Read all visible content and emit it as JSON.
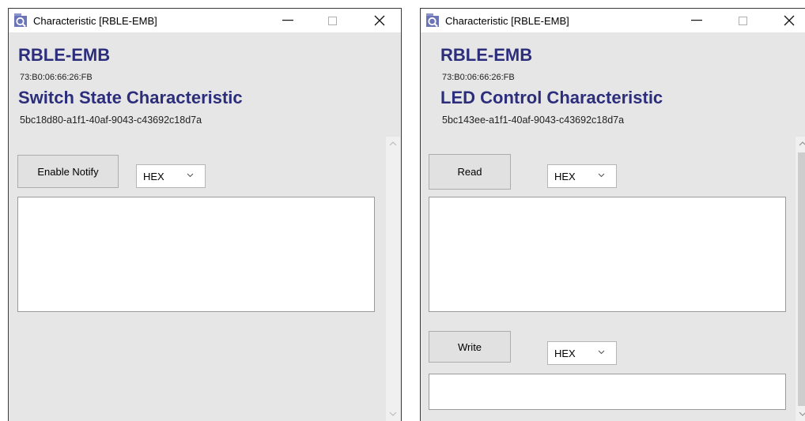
{
  "left_window": {
    "title": "Characteristic [RBLE-EMB]",
    "device_name": "RBLE-EMB",
    "device_address": "73:B0:06:66:26:FB",
    "characteristic_name": "Switch State Characteristic",
    "characteristic_uuid": "5bc18d80-a1f1-40af-9043-c43692c18d7a",
    "notify_button": "Enable Notify",
    "format_select": "HEX",
    "value_text": ""
  },
  "right_window": {
    "title": "Characteristic [RBLE-EMB]",
    "device_name": "RBLE-EMB",
    "device_address": "73:B0:06:66:26:FB",
    "characteristic_name": "LED Control Characteristic",
    "characteristic_uuid": "5bc143ee-a1f1-40af-9043-c43692c18d7a",
    "read_button": "Read",
    "read_format_select": "HEX",
    "read_value_text": "",
    "write_button": "Write",
    "write_format_select": "HEX",
    "write_value_text": ""
  },
  "icons": {
    "app": "bluetooth-scanner-icon",
    "minimize": "minimize-icon",
    "maximize": "maximize-icon",
    "close": "close-icon",
    "dropdown": "chevron-down-icon"
  },
  "colors": {
    "heading": "#2c2e7c",
    "window_bg": "#e6e6e6",
    "titlebar_bg": "#ffffff"
  }
}
